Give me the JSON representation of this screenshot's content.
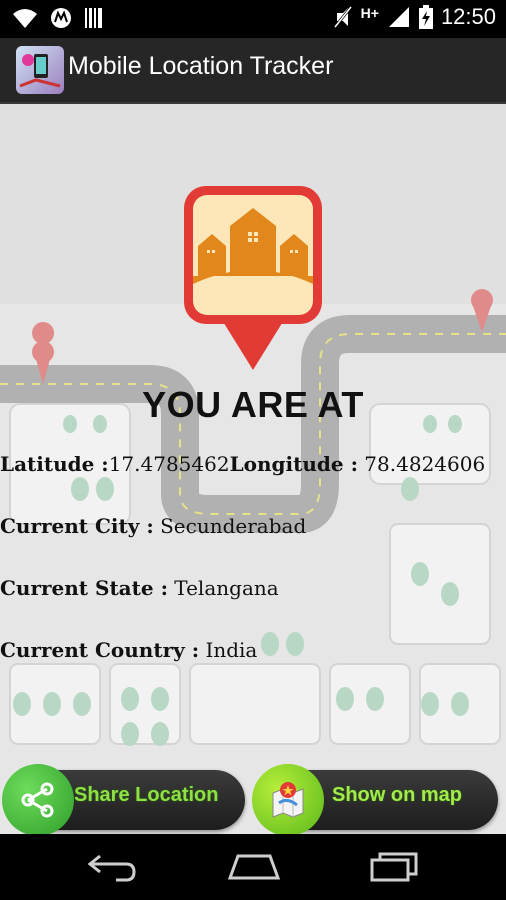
{
  "status_bar": {
    "time": "12:50",
    "network_label": "H+",
    "icons": [
      "wifi-icon",
      "motorola-icon",
      "barcode-icon",
      "mute-icon",
      "signal-icon",
      "battery-charging-icon"
    ]
  },
  "app_bar": {
    "title": "Mobile Location Tracker",
    "icon": "app-logo-icon"
  },
  "main": {
    "headline": "YOU ARE AT",
    "latitude_label": "Latitude :",
    "latitude_value": "17.4785462",
    "longitude_label": "Longitude :",
    "longitude_value": " 78.4824606",
    "city_label": "Current City :",
    "city_value": " Secunderabad",
    "state_label": "Current State :",
    "state_value": " Telangana",
    "country_label": "Current Country :",
    "country_value": " India"
  },
  "buttons": {
    "share_label": "Share Location",
    "map_label": "Show on map"
  },
  "nav_bar": {
    "icons": [
      "back-icon",
      "home-icon",
      "recents-icon"
    ]
  },
  "colors": {
    "pin_red": "#e23a35",
    "house_orange": "#e2871b",
    "button_green": "#8ee044"
  }
}
